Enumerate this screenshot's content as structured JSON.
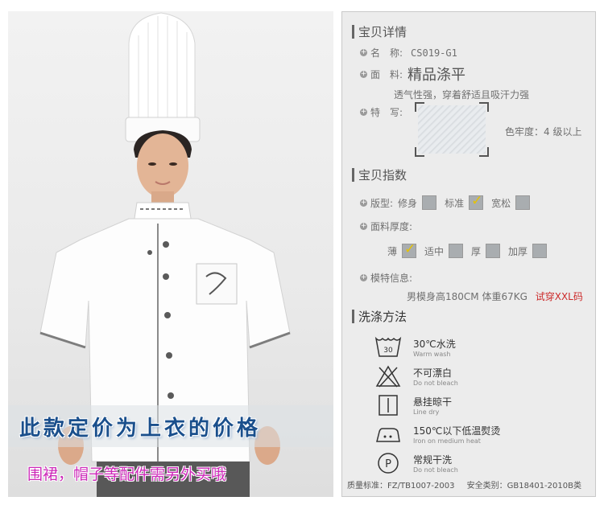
{
  "banner": {
    "price_note": "此款定价为上衣的价格",
    "accessory_note": "围裙，帽子等配件需另外买哦"
  },
  "details": {
    "title": "宝贝详情",
    "name_label": "名　称:",
    "name_value": "CS019-G1",
    "fabric_label": "面　料:",
    "fabric_value": "精品涤平",
    "fabric_desc": "透气性强，穿着舒适且吸汗力强",
    "closeup_label": "特　写:",
    "colorfast": "色牢度：4 级以上"
  },
  "index": {
    "title": "宝贝指数",
    "fit_label": "版型:",
    "fit_options": [
      {
        "label": "修身",
        "checked": false
      },
      {
        "label": "标准",
        "checked": true
      },
      {
        "label": "宽松",
        "checked": false
      }
    ],
    "thickness_label": "面料厚度:",
    "thickness_options": [
      {
        "label": "薄",
        "checked": true
      },
      {
        "label": "适中",
        "checked": false
      },
      {
        "label": "厚",
        "checked": false
      },
      {
        "label": "加厚",
        "checked": false
      }
    ],
    "model_label": "模特信息:",
    "model_info": "男模身高180CM 体重67KG",
    "model_size": "试穿XXL码"
  },
  "washing": {
    "title": "洗涤方法",
    "items": [
      {
        "icon": "wash-30-icon",
        "zh": "30℃水洗",
        "en": "Warm wash"
      },
      {
        "icon": "no-bleach-icon",
        "zh": "不可漂白",
        "en": "Do not bleach"
      },
      {
        "icon": "line-dry-icon",
        "zh": "悬挂晾干",
        "en": "Line dry"
      },
      {
        "icon": "iron-medium-icon",
        "zh": "150℃以下低温熨烫",
        "en": "Iron on medium heat"
      },
      {
        "icon": "dry-clean-icon",
        "zh": "常规干洗",
        "en": "Do not bleach"
      }
    ],
    "tub_temp": "30"
  },
  "footer": {
    "standard": "质量标准：FZ/TB1007-2003",
    "safety": "安全类别：GB18401-2010B类"
  },
  "colors": {
    "accent_red": "#cc2a2a",
    "banner_blue": "#1a4f8c",
    "banner_pink": "#cc28b8",
    "check_yellow": "#e6c200"
  }
}
